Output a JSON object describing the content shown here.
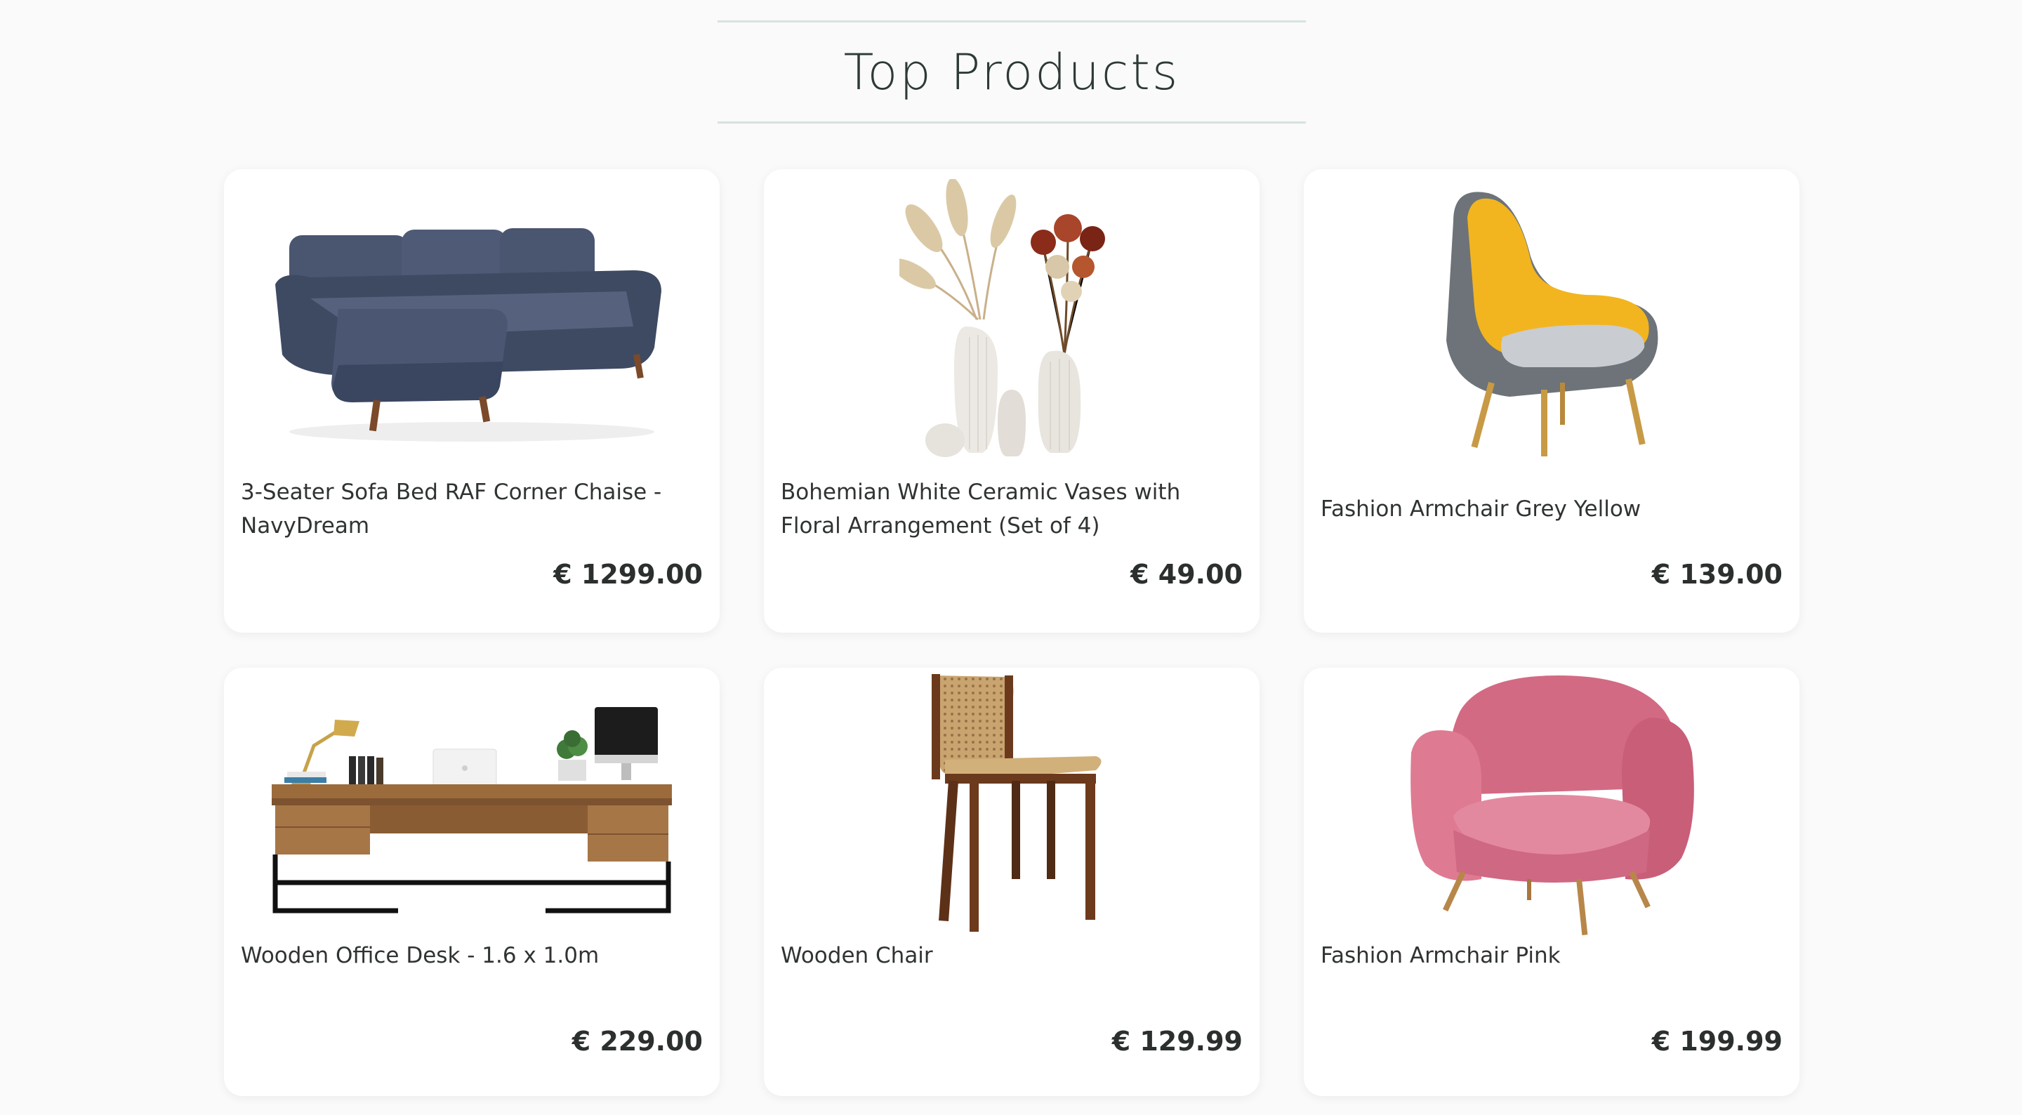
{
  "section": {
    "title": "Top Products"
  },
  "products": [
    {
      "name": "3-Seater Sofa Bed RAF Corner Chaise - NavyDream",
      "price": "€ 1299.00",
      "image": "navy-corner-sofa"
    },
    {
      "name": "Bohemian White Ceramic Vases with Floral Arrangement (Set of 4)",
      "price": "€ 49.00",
      "image": "ceramic-vases-dried-flowers"
    },
    {
      "name": "Fashion Armchair Grey Yellow",
      "price": "€ 139.00",
      "image": "grey-yellow-armchair"
    },
    {
      "name": "Wooden Office Desk - 1.6 x 1.0m",
      "price": "€ 229.00",
      "image": "wooden-office-desk"
    },
    {
      "name": "Wooden Chair",
      "price": "€ 129.99",
      "image": "rattan-wooden-chair"
    },
    {
      "name": "Fashion Armchair Pink",
      "price": "€ 199.99",
      "image": "pink-armchair"
    }
  ],
  "colors": {
    "background": "#fafafa",
    "card": "#ffffff",
    "divider": "#d6e3db",
    "text": "#2b2f2e"
  }
}
